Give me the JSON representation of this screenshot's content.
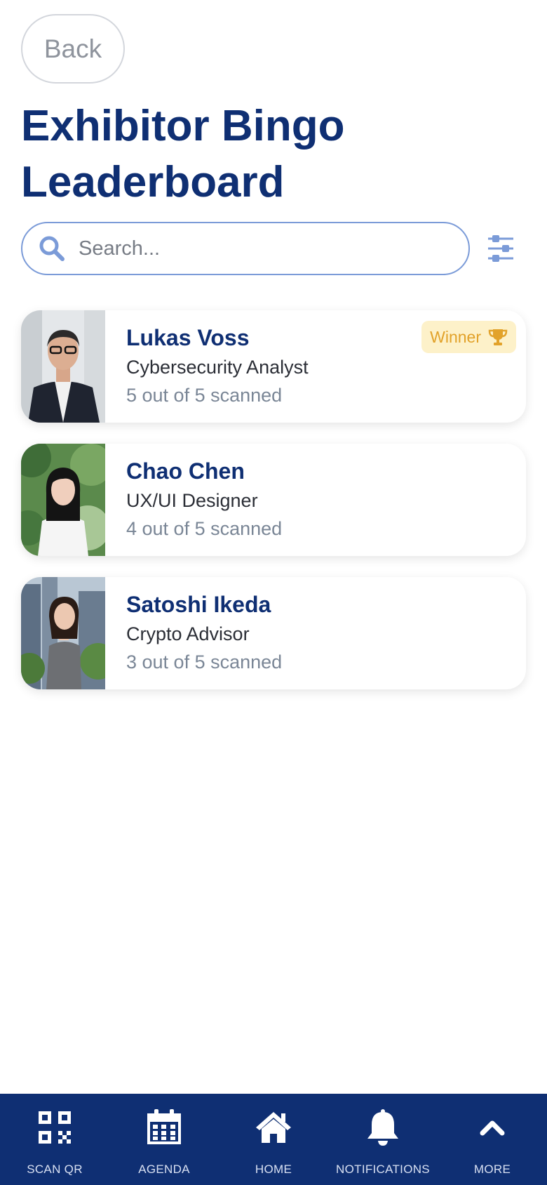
{
  "header": {
    "back_label": "Back",
    "title": "Exhibitor Bingo Leaderboard"
  },
  "search": {
    "placeholder": "Search...",
    "value": ""
  },
  "icons": {
    "search": "search-icon",
    "filter": "sliders-icon",
    "winner": "trophy-icon"
  },
  "leaderboard": [
    {
      "name": "Lukas Voss",
      "role": "Cybersecurity Analyst",
      "scanned": "5 out of 5 scanned",
      "badge": "Winner"
    },
    {
      "name": "Chao Chen",
      "role": "UX/UI Designer",
      "scanned": "4 out of 5 scanned",
      "badge": ""
    },
    {
      "name": "Satoshi Ikeda",
      "role": "Crypto Advisor",
      "scanned": "3 out of 5 scanned",
      "badge": ""
    }
  ],
  "nav": [
    {
      "label": "SCAN QR",
      "icon": "qr-code-icon"
    },
    {
      "label": "AGENDA",
      "icon": "calendar-icon"
    },
    {
      "label": "HOME",
      "icon": "home-icon"
    },
    {
      "label": "NOTIFICATIONS",
      "icon": "bell-icon"
    },
    {
      "label": "MORE",
      "icon": "chevron-up-icon"
    }
  ],
  "colors": {
    "primary": "#0f2f73",
    "search_border": "#7b9bd8",
    "winner_bg": "#fdf1c9",
    "winner_text": "#e2a22a",
    "muted_text": "#7a8696"
  }
}
